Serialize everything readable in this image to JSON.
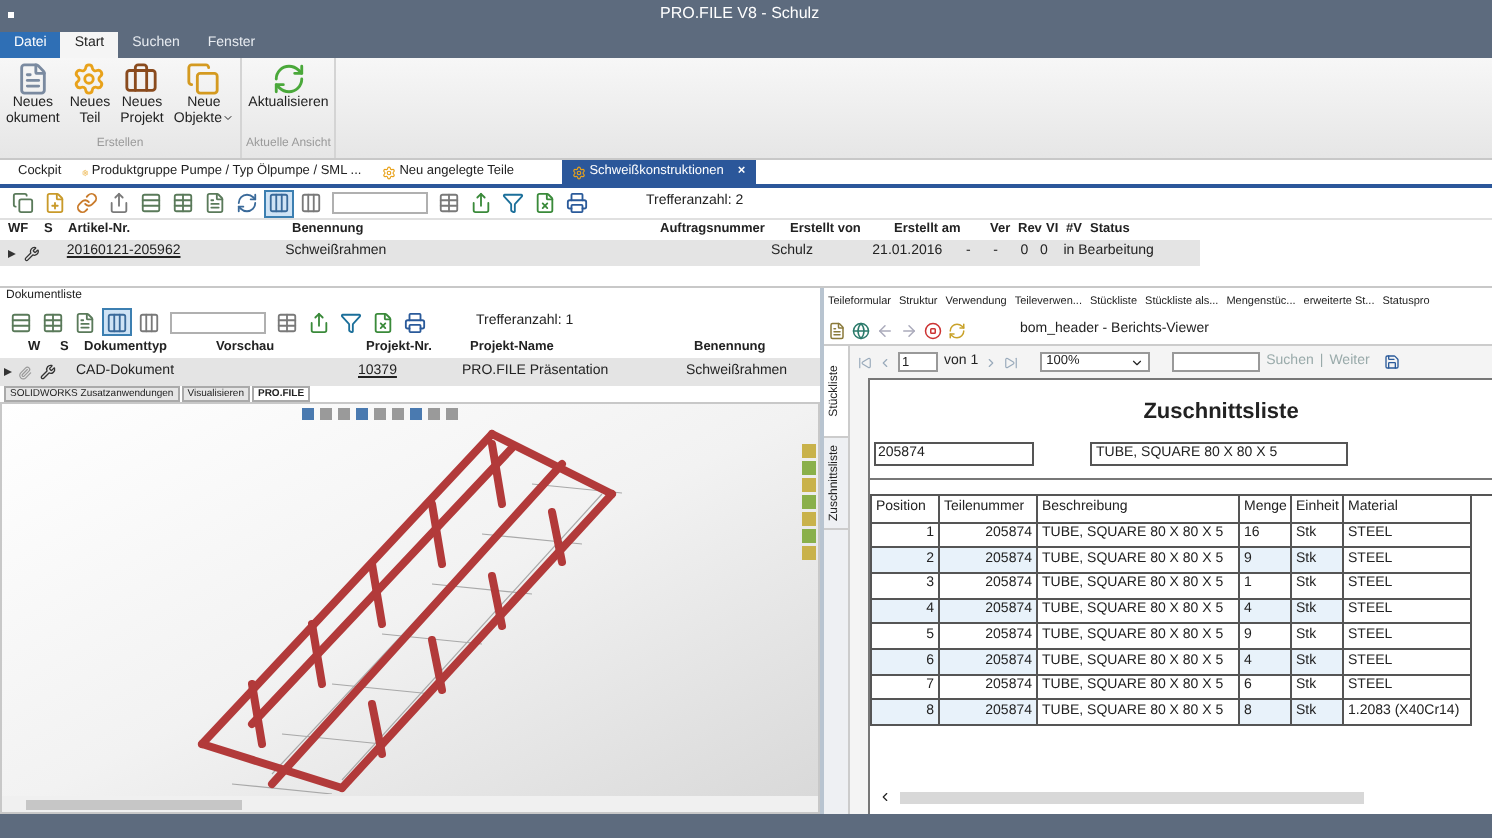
{
  "window": {
    "title": "PRO.FILE V8 - Schulz"
  },
  "ribbon_tabs": [
    {
      "label": "Datei",
      "kind": "file",
      "selected": false
    },
    {
      "label": "Start",
      "kind": "tab",
      "selected": true
    },
    {
      "label": "Suchen",
      "kind": "tab",
      "selected": false
    },
    {
      "label": "Fenster",
      "kind": "tab",
      "selected": false
    }
  ],
  "ribbon_groups": [
    {
      "label": "Erstellen",
      "buttons": [
        {
          "lines": [
            "Neues",
            "okument"
          ],
          "dropdown": false
        },
        {
          "lines": [
            "Neues",
            "Teil"
          ],
          "dropdown": false
        },
        {
          "lines": [
            "Neues",
            "Projekt"
          ],
          "dropdown": false
        },
        {
          "lines": [
            "Neue",
            "Objekte"
          ],
          "dropdown": true
        }
      ]
    },
    {
      "label": "Aktuelle Ansicht",
      "buttons": [
        {
          "lines": [
            "Aktualisieren"
          ],
          "dropdown": false
        }
      ]
    }
  ],
  "doc_tabs": [
    {
      "label": "Cockpit",
      "icon": false,
      "selected": false
    },
    {
      "label": "Produktgruppe Pumpe / Typ Ölpumpe / SML ...",
      "icon": true,
      "selected": false
    },
    {
      "label": "Neu angelegte Teile",
      "icon": true,
      "selected": false
    },
    {
      "label": "Schweißkonstruktionen",
      "icon": true,
      "selected": true,
      "close": "×"
    }
  ],
  "top_toolbar": {
    "hits": "Trefferanzahl: 2"
  },
  "top_table": {
    "columns": [
      "WF",
      "S",
      "Artikel-Nr.",
      "Benennung",
      "Auftragsnummer",
      "Erstellt von",
      "Erstellt am",
      "Ver",
      "Rev",
      "VI",
      "#V",
      "Status"
    ],
    "rows": [
      {
        "expanded": false,
        "article_no": "20160121-205962",
        "name": "Schweißrahmen",
        "created_by": "Schulz",
        "created_on": "21.01.2016",
        "ver": "-",
        "rev": "-",
        "vi": "0",
        "v_count": "0",
        "status": "in Bearbeitung"
      }
    ]
  },
  "doc_list": {
    "title": "Dokumentliste",
    "hits": "Trefferanzahl: 1",
    "columns": [
      "W",
      "S",
      "Dokumenttyp",
      "Vorschau",
      "Projekt-Nr.",
      "Projekt-Name",
      "Benennung"
    ],
    "rows": [
      {
        "expanded": false,
        "type": "CAD-Dokument",
        "project_no": "10379",
        "project_name": "PRO.FILE Präsentation",
        "name": "Schweißrahmen"
      }
    ]
  },
  "cad_tabs": [
    {
      "label": "SOLIDWORKS Zusatzanwendungen",
      "selected": false
    },
    {
      "label": "Visualisieren",
      "selected": false
    },
    {
      "label": "PRO.FILE",
      "selected": true
    }
  ],
  "detail_tabs": [
    "Teileformular",
    "Struktur",
    "Verwendung",
    "Teileverwen...",
    "Stückliste",
    "Stückliste als...",
    "Mengenstüc...",
    "erweiterte St...",
    "Statuspro"
  ],
  "viewer": {
    "title": "bom_header - Berichts-Viewer"
  },
  "side_tabs": [
    {
      "label": "Stückliste",
      "selected": true
    },
    {
      "label": "Zuschnittsliste",
      "selected": false
    }
  ],
  "report_toolbar": {
    "page": "1",
    "of": "von 1",
    "zoom": "100%",
    "find": "Suchen",
    "separator": "|",
    "next": "Weiter"
  },
  "report": {
    "title": "Zuschnittsliste",
    "part_no": "205874",
    "description": "TUBE, SQUARE 80 X 80 X 5",
    "columns": [
      "Position",
      "Teilenummer",
      "Beschreibung",
      "Menge",
      "Einheit",
      "Material"
    ],
    "rows": [
      [
        "1",
        "205874",
        "TUBE, SQUARE 80 X 80 X 5",
        "16",
        "Stk",
        "STEEL"
      ],
      [
        "2",
        "205874",
        "TUBE, SQUARE 80 X 80 X 5",
        "9",
        "Stk",
        "STEEL"
      ],
      [
        "3",
        "205874",
        "TUBE, SQUARE 80 X 80 X 5",
        "1",
        "Stk",
        "STEEL"
      ],
      [
        "4",
        "205874",
        "TUBE, SQUARE 80 X 80 X 5",
        "4",
        "Stk",
        "STEEL"
      ],
      [
        "5",
        "205874",
        "TUBE, SQUARE 80 X 80 X 5",
        "9",
        "Stk",
        "STEEL"
      ],
      [
        "6",
        "205874",
        "TUBE, SQUARE 80 X 80 X 5",
        "4",
        "Stk",
        "STEEL"
      ],
      [
        "7",
        "205874",
        "TUBE, SQUARE 80 X 80 X 5",
        "6",
        "Stk",
        "STEEL"
      ],
      [
        "8",
        "205874",
        "TUBE, SQUARE 80 X 80 X 5",
        "8",
        "Stk",
        "1.2083 (X40Cr14)"
      ]
    ]
  }
}
